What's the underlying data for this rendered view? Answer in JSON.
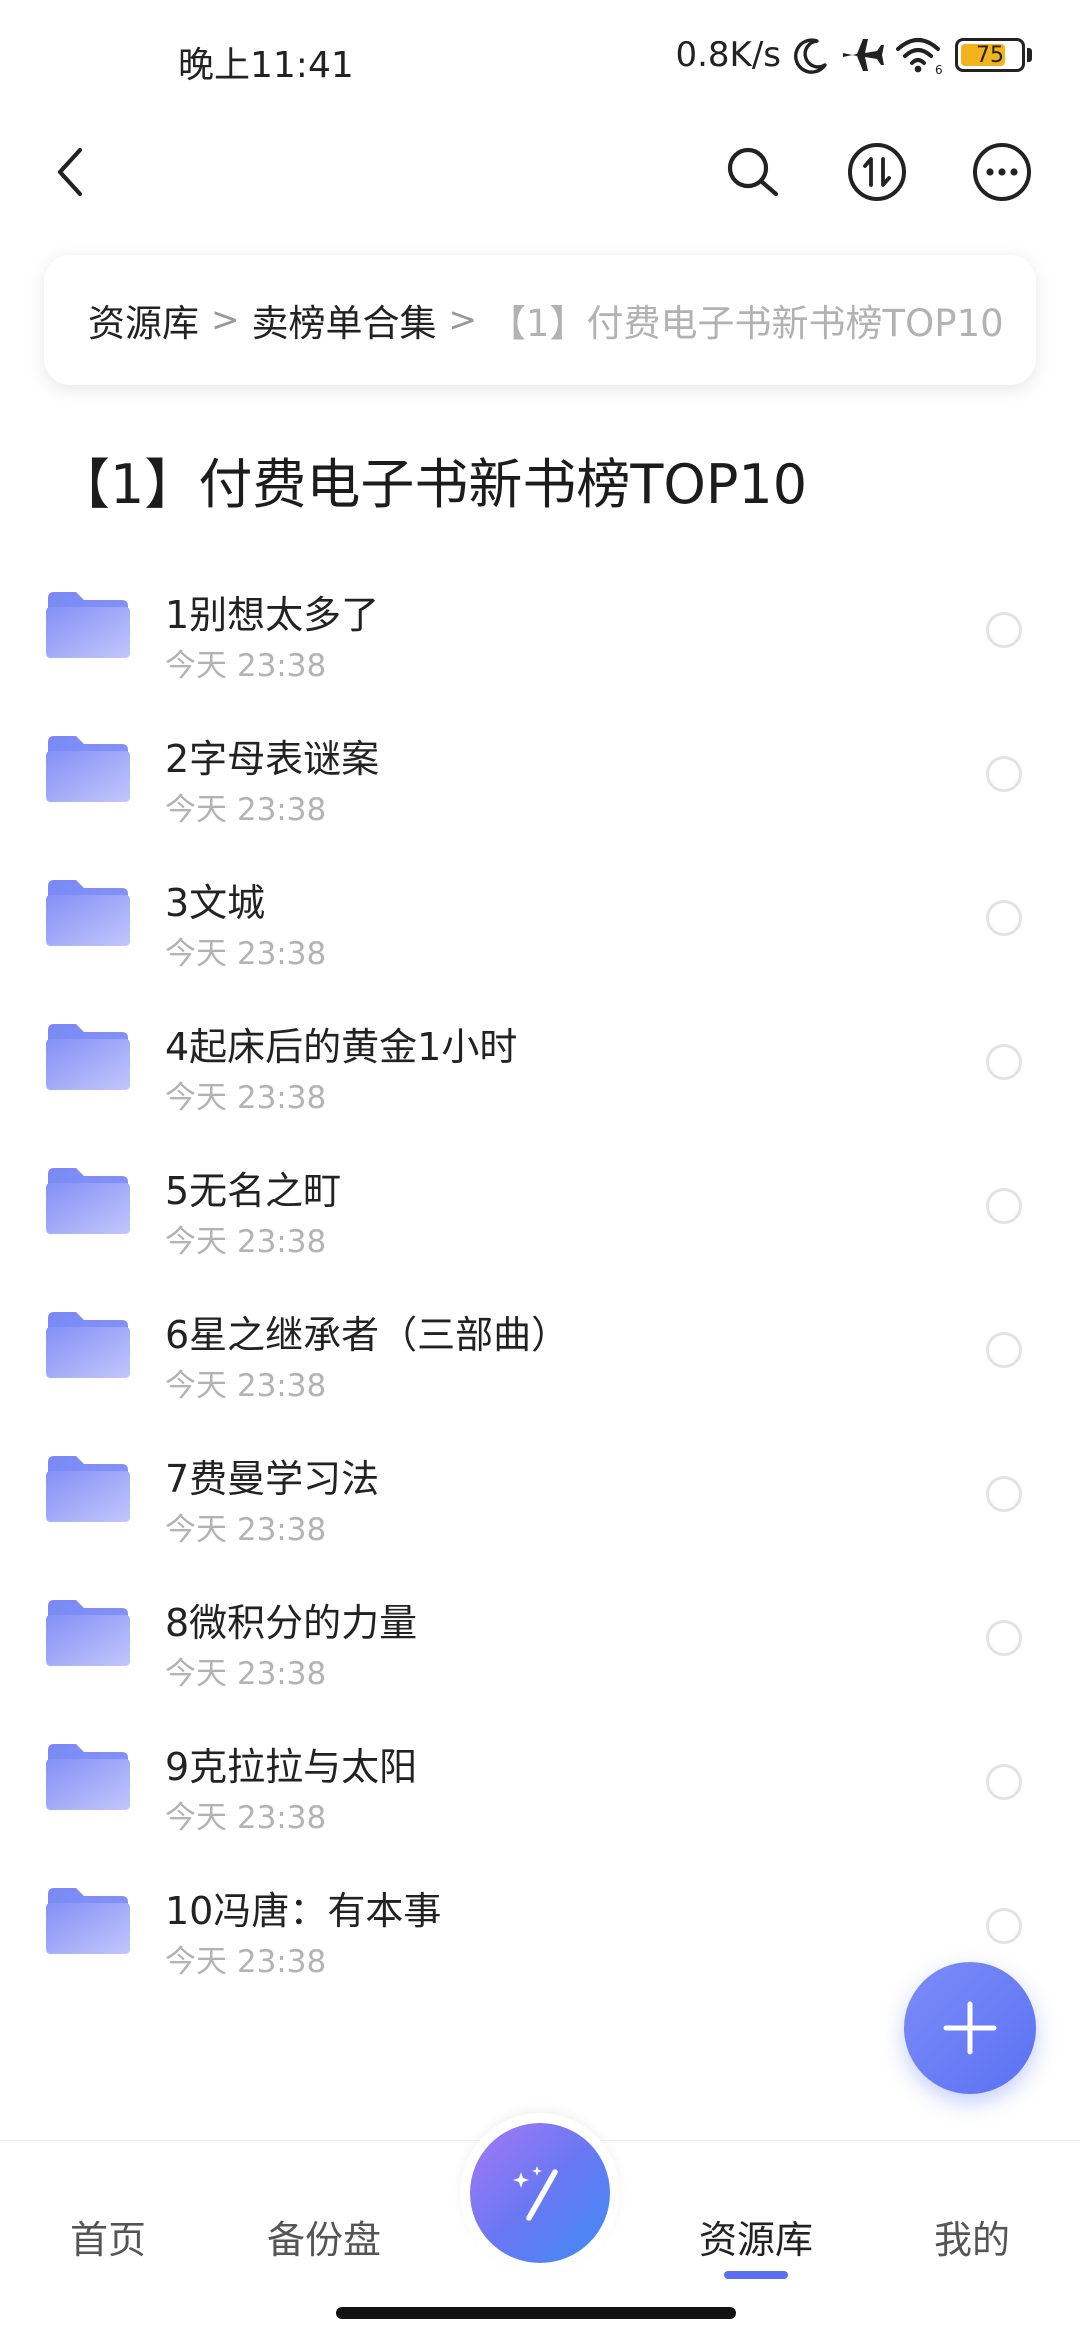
{
  "status_bar": {
    "time": "晚上11:41",
    "network_speed": "0.8K/s",
    "battery_level": "75",
    "battery_fraction": 0.75,
    "icons": [
      "moon-icon",
      "airplane-icon",
      "wifi-icon",
      "battery-icon"
    ]
  },
  "top_nav": {
    "icons": [
      "back-arrow-icon",
      "search-icon",
      "sort-icon",
      "more-icon"
    ]
  },
  "breadcrumb": {
    "items": [
      "资源库",
      "卖榜单合集",
      "【1】付费电子书新书榜TOP10"
    ],
    "separator": ">"
  },
  "page_title": "【1】付费电子书新书榜TOP10",
  "files": [
    {
      "name": "1别想太多了",
      "date": "今天 23:38"
    },
    {
      "name": "2字母表谜案",
      "date": "今天 23:38"
    },
    {
      "name": "3文城",
      "date": "今天 23:38"
    },
    {
      "name": "4起床后的黄金1小时",
      "date": "今天 23:38"
    },
    {
      "name": "5无名之町",
      "date": "今天 23:38"
    },
    {
      "name": "6星之继承者（三部曲）",
      "date": "今天 23:38"
    },
    {
      "name": "7费曼学习法",
      "date": "今天 23:38"
    },
    {
      "name": "8微积分的力量",
      "date": "今天 23:38"
    },
    {
      "name": "9克拉拉与太阳",
      "date": "今天 23:38"
    },
    {
      "name": "10冯唐：有本事",
      "date": "今天 23:38"
    }
  ],
  "fab_icon": "plus-icon",
  "bottom_nav": {
    "tabs": [
      {
        "label": "首页",
        "active": false
      },
      {
        "label": "备份盘",
        "active": false
      },
      {
        "label": "资源库",
        "active": true
      },
      {
        "label": "我的",
        "active": false
      }
    ],
    "center_icon": "magic-wand-icon"
  },
  "colors": {
    "accent": "#5b6ff0",
    "folder": "#7f8ef6",
    "battery": "#f2b31c",
    "secondary_text": "#b3b3b3"
  }
}
